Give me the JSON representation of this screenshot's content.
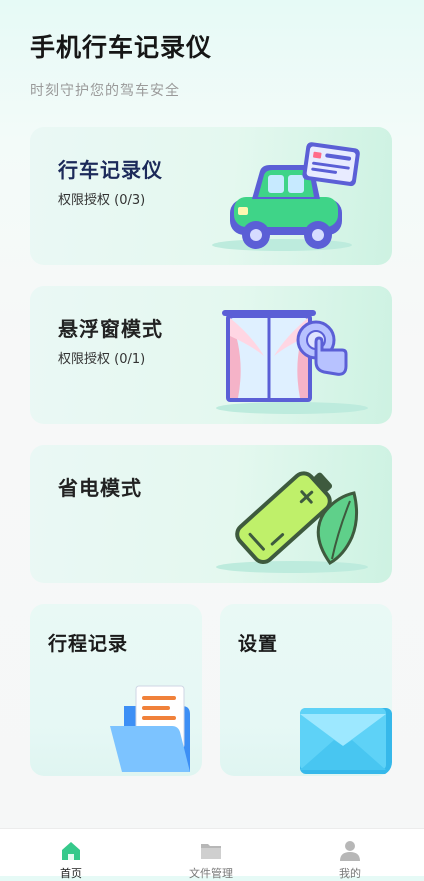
{
  "header": {
    "title": "手机行车记录仪",
    "subtitle": "时刻守护您的驾车安全"
  },
  "cards": {
    "dashcam": {
      "title": "行车记录仪",
      "subtitle": "权限授权 (0/3)",
      "icon": "car-dashcam-illustration"
    },
    "float": {
      "title": "悬浮窗模式",
      "subtitle": "权限授权 (0/1)",
      "icon": "window-tap-illustration"
    },
    "power": {
      "title": "省电模式",
      "icon": "battery-leaf-illustration"
    },
    "trips": {
      "title": "行程记录",
      "icon": "folder-document-illustration"
    },
    "settings": {
      "title": "设置",
      "icon": "envelope-illustration"
    }
  },
  "tabs": [
    {
      "label": "首页",
      "icon": "home-icon",
      "active": true
    },
    {
      "label": "文件管理",
      "icon": "folder-icon",
      "active": false
    },
    {
      "label": "我的",
      "icon": "user-icon",
      "active": false
    }
  ],
  "colors": {
    "accent": "#3ad39a",
    "card_bg": "#e4f8ef",
    "title_dark": "#1c2a5a"
  }
}
